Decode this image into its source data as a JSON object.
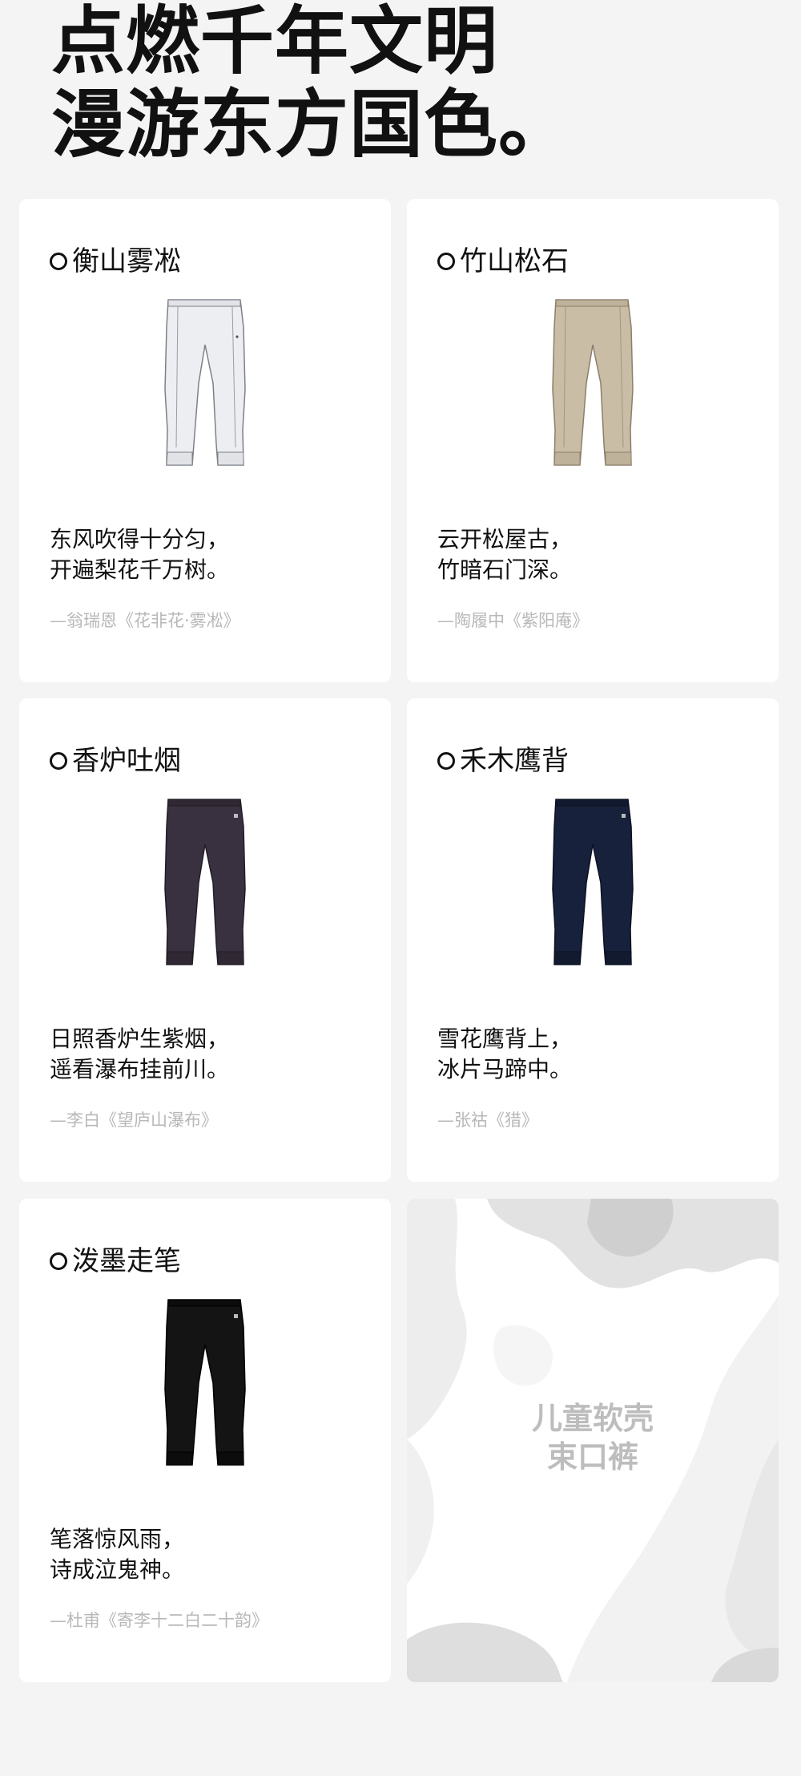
{
  "headline": {
    "line1": "点燃千年文明",
    "line2": "漫游东方国色。"
  },
  "cards": [
    {
      "title": "衡山雾凇",
      "color_name_icon": "circle-outline-icon",
      "garment_color": "#eceef2",
      "cuff_color": "#e1e3e7",
      "poem_line1": "东风吹得十分匀，",
      "poem_line2": "开遍梨花千万树。",
      "source": "—翁瑞恩《花非花·雾凇》"
    },
    {
      "title": "竹山松石",
      "color_name_icon": "circle-outline-icon",
      "garment_color": "#c9bda6",
      "cuff_color": "#bfb29a",
      "poem_line1": "云开松屋古，",
      "poem_line2": "竹暗石门深。",
      "source": "—陶履中《紫阳庵》"
    },
    {
      "title": "香炉吐烟",
      "color_name_icon": "circle-outline-icon",
      "garment_color": "#3a3140",
      "cuff_color": "#302833",
      "poem_line1": "日照香炉生紫烟，",
      "poem_line2": "遥看瀑布挂前川。",
      "source": "—李白《望庐山瀑布》"
    },
    {
      "title": "禾木鹰背",
      "color_name_icon": "circle-outline-icon",
      "garment_color": "#17213b",
      "cuff_color": "#121a2f",
      "poem_line1": "雪花鹰背上，",
      "poem_line2": "冰片马蹄中。",
      "source": "—张祜《猎》"
    },
    {
      "title": "泼墨走笔",
      "color_name_icon": "circle-outline-icon",
      "garment_color": "#141414",
      "cuff_color": "#0c0c0c",
      "poem_line1": "笔落惊风雨，",
      "poem_line2": "诗成泣鬼神。",
      "source": "—杜甫《寄李十二白二十韵》"
    }
  ],
  "product": {
    "name_line1": "儿童软壳",
    "name_line2": "束口裤"
  }
}
